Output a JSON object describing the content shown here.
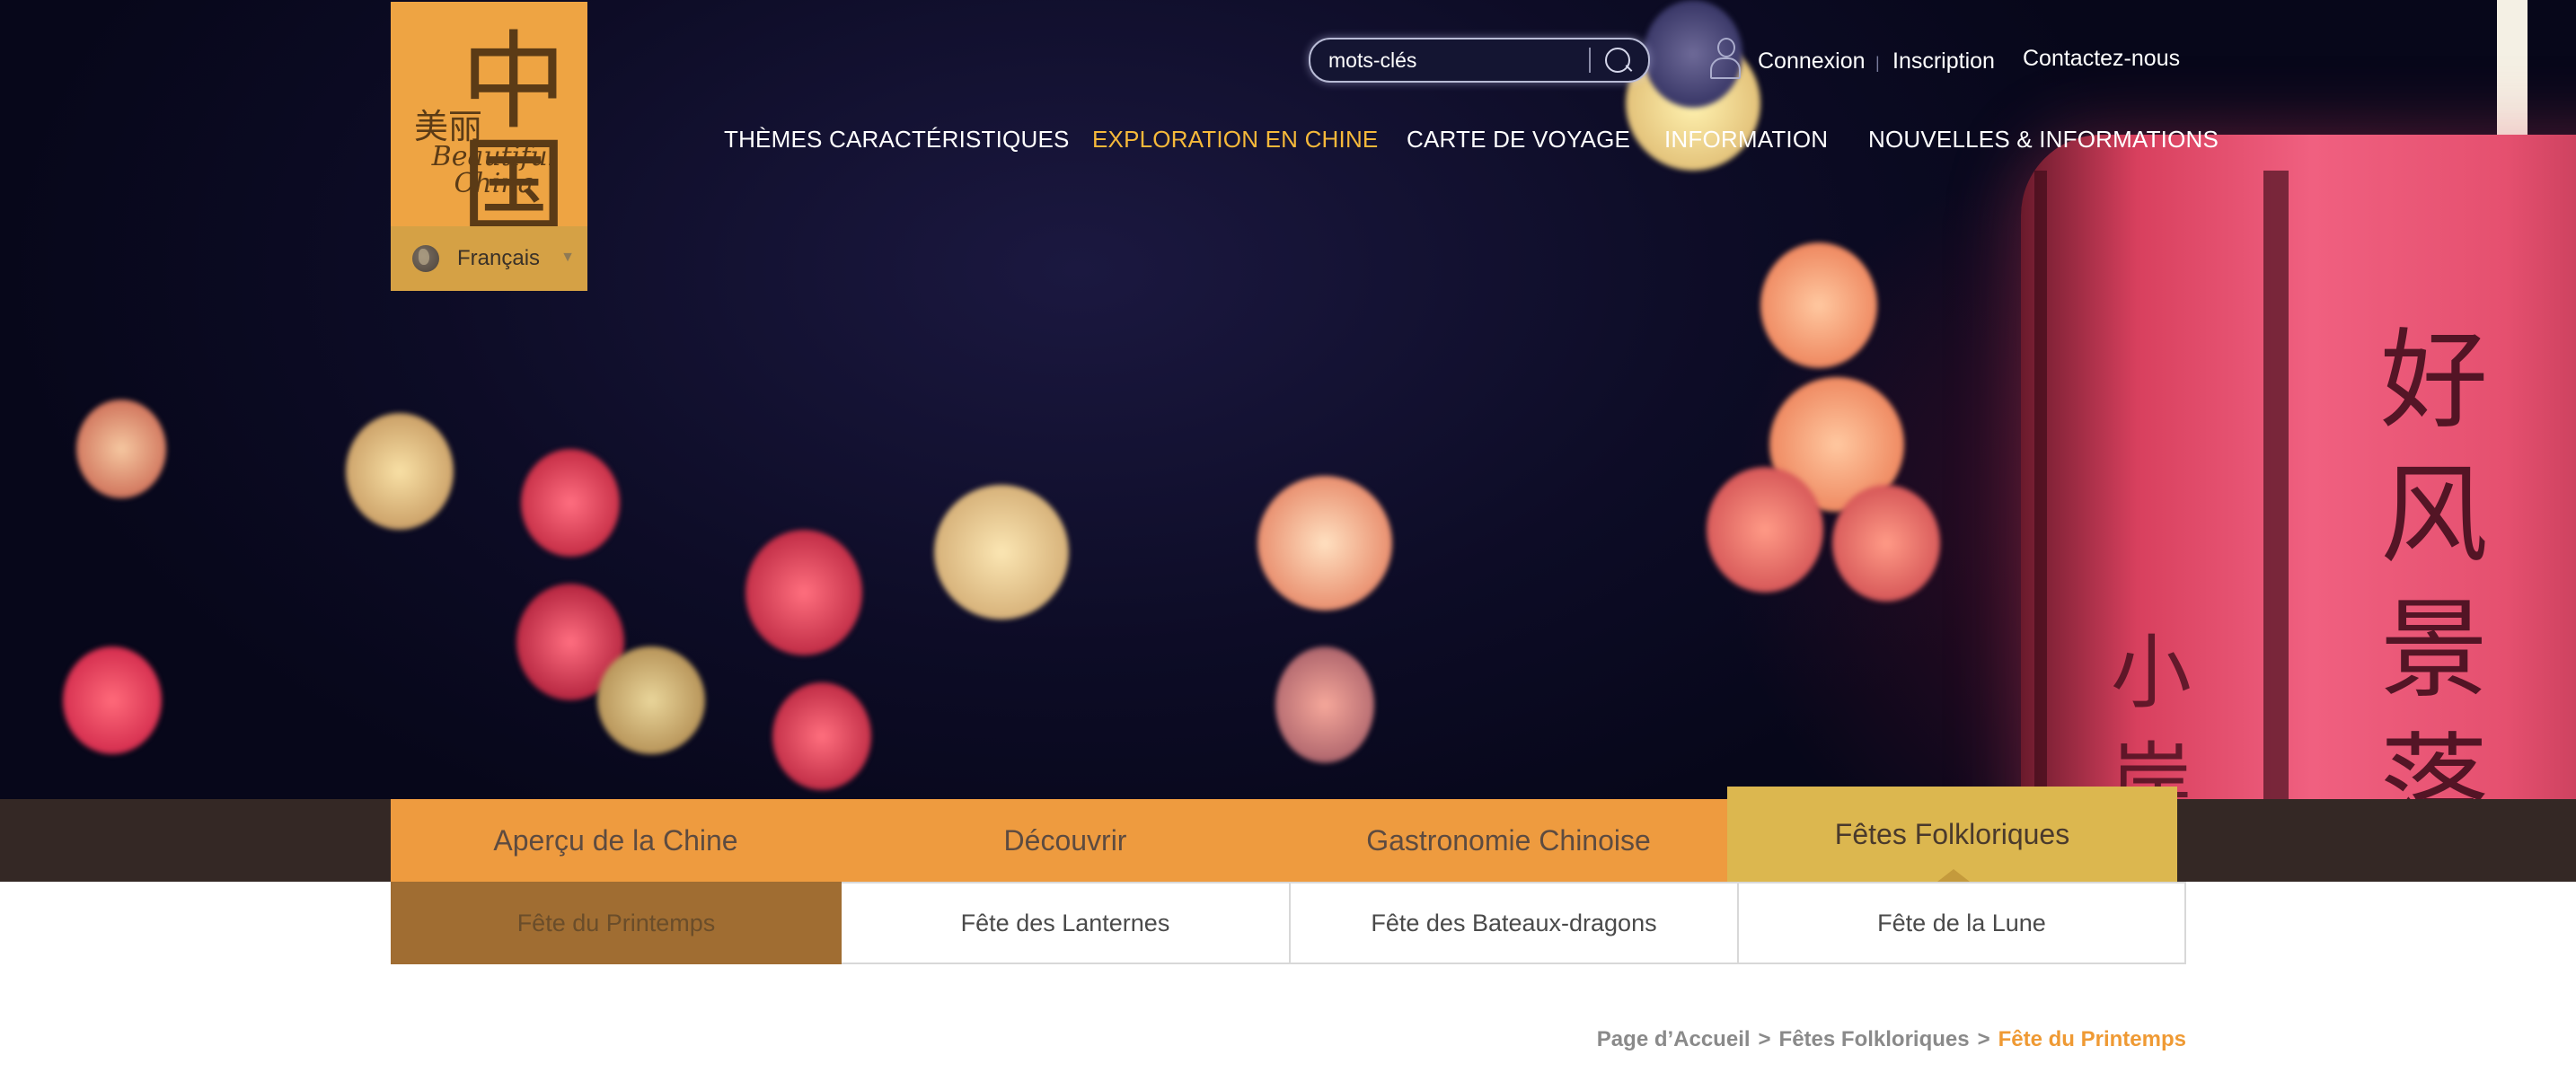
{
  "logo": {
    "han_small": "美丽",
    "han_big": "中国",
    "script_line1": "Beautiful",
    "script_line2": "China"
  },
  "language": {
    "selected": "Français"
  },
  "search": {
    "placeholder": "mots-clés"
  },
  "user_links": {
    "login": "Connexion",
    "divider": "|",
    "register": "Inscription",
    "contact": "Contactez-nous"
  },
  "main_nav": [
    {
      "label": "THÈMES CARACTÉRISTIQUES"
    },
    {
      "label": "EXPLORATION EN CHINE",
      "active": true
    },
    {
      "label": "CARTE DE VOYAGE"
    },
    {
      "label": "INFORMATION"
    },
    {
      "label": "NOUVELLES & INFORMATIONS"
    }
  ],
  "hero": {
    "lantern_text_1": "好风景落",
    "lantern_text_2": "小岸"
  },
  "tabs": [
    {
      "label": "Aperçu de la Chine"
    },
    {
      "label": "Découvrir"
    },
    {
      "label": "Gastronomie Chinoise"
    },
    {
      "label": "Fêtes Folkloriques",
      "active": true
    }
  ],
  "subtabs": [
    {
      "label": "Fête du Printemps",
      "active": true
    },
    {
      "label": "Fête des Lanternes"
    },
    {
      "label": "Fête des Bateaux-dragons"
    },
    {
      "label": "Fête de la Lune"
    }
  ],
  "breadcrumb": {
    "items": [
      "Page d’Accueil",
      "Fêtes Folkloriques"
    ],
    "separator": ">",
    "current": "Fête du Printemps"
  },
  "colors": {
    "accent_orange": "#ee9b3f",
    "active_tab": "#dcb74f",
    "active_subtab": "#a06d32",
    "nav_active": "#f6b93a",
    "breadcrumb_current": "#ef9a34",
    "tabbar_bg": "#342825"
  },
  "icons": {
    "search": "search-icon",
    "user": "user-icon",
    "globe": "globe-icon",
    "dropdown": "chevron-down-icon"
  }
}
